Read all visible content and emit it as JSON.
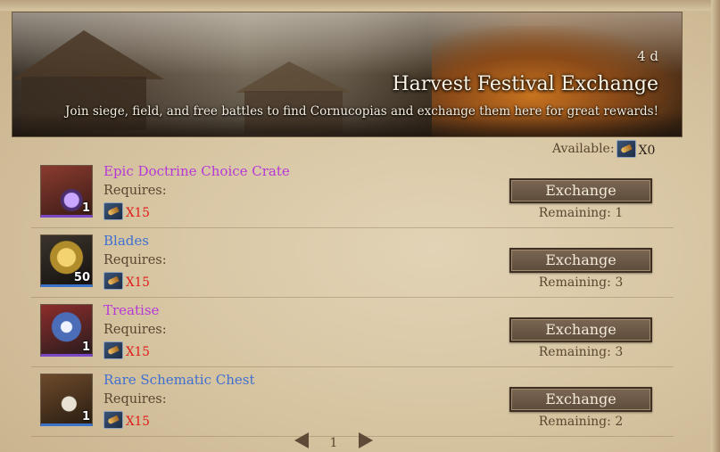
{
  "banner": {
    "days_left": "4 d",
    "title": "Harvest Festival Exchange",
    "subtitle": "Join siege, field, and free battles to find Cornucopias and exchange them here for great rewards!"
  },
  "available": {
    "label": "Available:",
    "count": "X0",
    "icon": "cornucopia-icon"
  },
  "items": [
    {
      "name": "Epic Doctrine Choice Crate",
      "rarity_color": "#b538d6",
      "qty": "1",
      "icon": "crate-icon",
      "requires": "Requires:",
      "cost": "X15",
      "button": "Exchange",
      "remaining": "Remaining: 1"
    },
    {
      "name": "Blades",
      "rarity_color": "#3f6fd1",
      "qty": "50",
      "icon": "blades-icon",
      "requires": "Requires:",
      "cost": "X15",
      "button": "Exchange",
      "remaining": "Remaining: 3"
    },
    {
      "name": "Treatise",
      "rarity_color": "#b538d6",
      "qty": "1",
      "icon": "treatise-icon",
      "requires": "Requires:",
      "cost": "X15",
      "button": "Exchange",
      "remaining": "Remaining: 3"
    },
    {
      "name": "Rare Schematic Chest",
      "rarity_color": "#3f6fd1",
      "qty": "1",
      "icon": "chest-icon",
      "requires": "Requires:",
      "cost": "X15",
      "button": "Exchange",
      "remaining": "Remaining: 2"
    }
  ],
  "pagination": {
    "page": "1"
  }
}
